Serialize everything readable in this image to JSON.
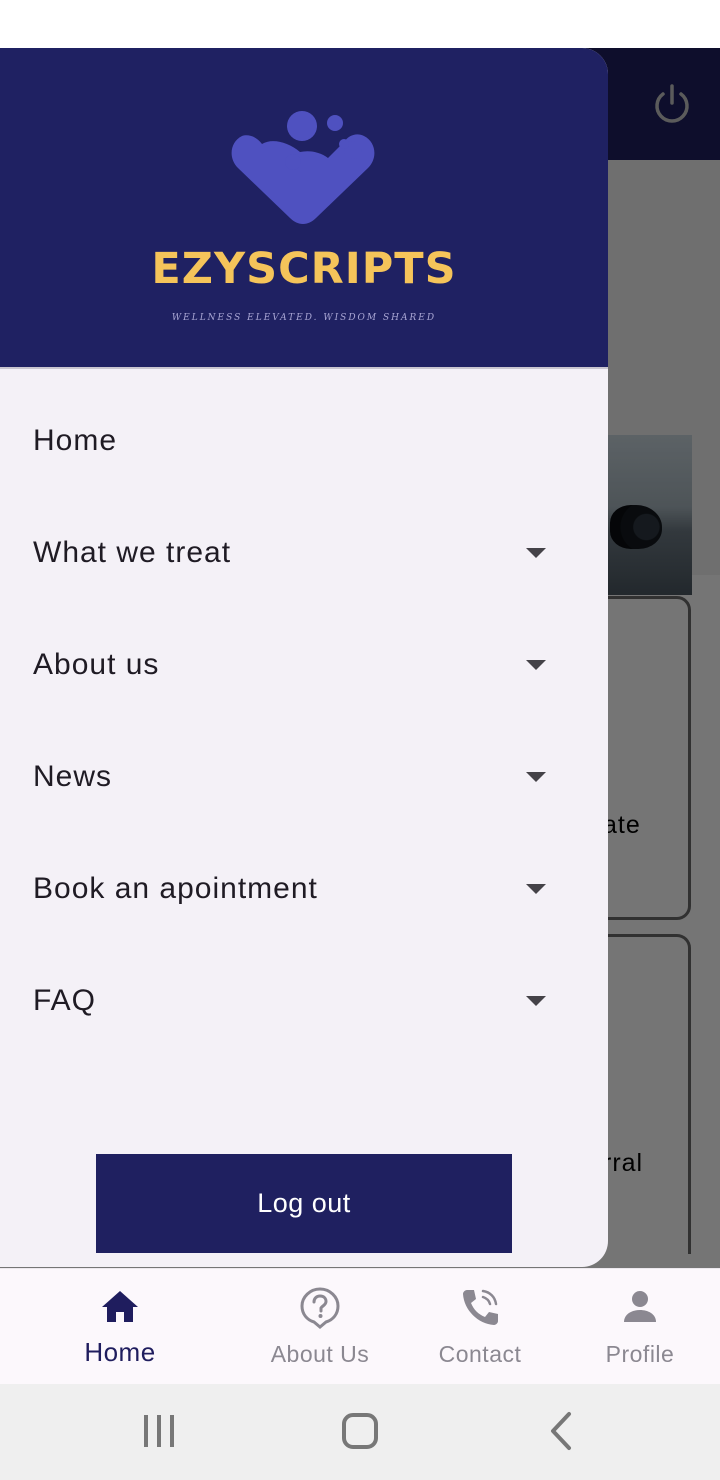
{
  "brand": {
    "name": "EZYSCRIPTS",
    "tagline": "WELLNESS ELEVATED. WISDOM SHARED",
    "colors": {
      "primary": "#1f2060",
      "accent": "#f5c45a",
      "logo": "#4f51c0"
    }
  },
  "background": {
    "card1_text": "ate",
    "card2_text": "rral"
  },
  "drawer": {
    "items": [
      {
        "label": "Home",
        "expandable": false
      },
      {
        "label": "What we treat",
        "expandable": true
      },
      {
        "label": "About us",
        "expandable": true
      },
      {
        "label": "News",
        "expandable": true
      },
      {
        "label": "Book an apointment",
        "expandable": true
      },
      {
        "label": "FAQ",
        "expandable": true
      }
    ],
    "logout_label": "Log out"
  },
  "bottom_nav": {
    "items": [
      {
        "label": "Home",
        "icon": "home-icon",
        "active": true
      },
      {
        "label": "About Us",
        "icon": "help-icon",
        "active": false
      },
      {
        "label": "Contact",
        "icon": "phone-icon",
        "active": false
      },
      {
        "label": "Profile",
        "icon": "person-icon",
        "active": false
      }
    ]
  },
  "system_nav": {
    "icons": [
      "recent-apps-icon",
      "home-circle-icon",
      "back-icon"
    ]
  }
}
